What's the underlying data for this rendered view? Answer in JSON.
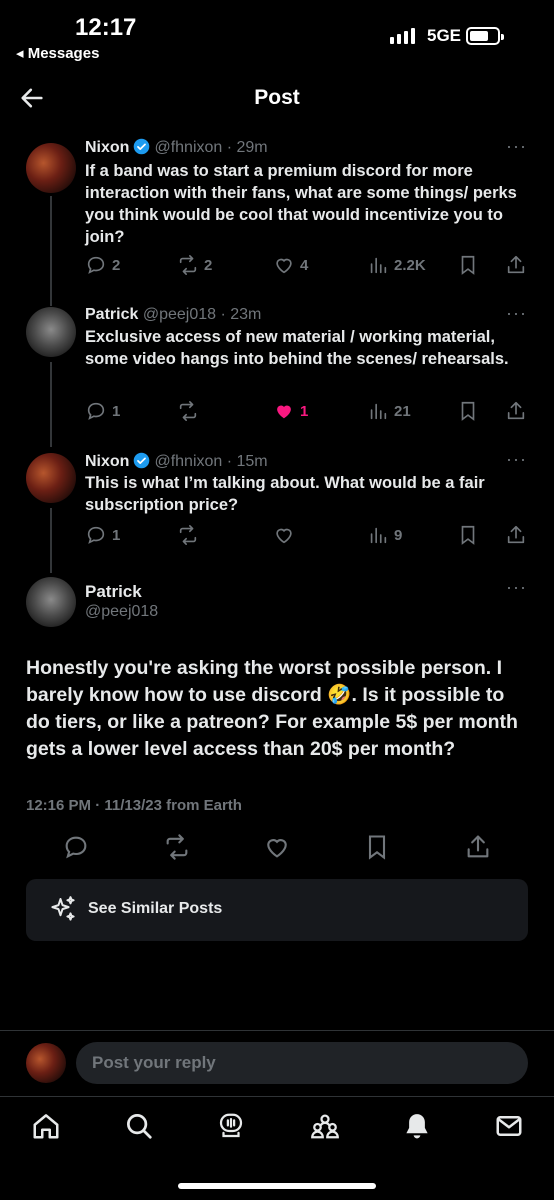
{
  "status_bar": {
    "time": "12:17",
    "back_app": "◂ Messages",
    "network": "5GE"
  },
  "header": {
    "title": "Post"
  },
  "replies": [
    {
      "name": "Nixon",
      "verified": true,
      "handle": "@fhnixon · 29m",
      "text": "If a band was to start a premium discord for more interaction with their fans, what are some things/ perks you think would be cool that would incentivize you to join?",
      "replies_count": "2",
      "reposts_count": "2",
      "likes_count": "4",
      "views_count": "2.2K"
    },
    {
      "name": "Patrick",
      "verified": false,
      "handle": "@peej018 · 23m",
      "text": "Exclusive access of new material / working material, some video hangs into behind the scenes/ rehearsals.",
      "replies_count": "1",
      "reposts_count": "",
      "likes_count": "1",
      "views_count": "21"
    },
    {
      "name": "Nixon",
      "verified": true,
      "handle": "@fhnixon · 15m",
      "text": "This is what I’m talking about. What would be a fair subscription price?",
      "replies_count": "1",
      "reposts_count": "",
      "likes_count": "",
      "views_count": "9"
    }
  ],
  "main_post": {
    "name": "Patrick",
    "handle": "@peej018",
    "text": "Honestly you're asking the worst possible person. I barely know how to use discord 🤣. Is it possible to do tiers, or like a patreon? For example 5$ per month gets a lower level access than 20$ per month?",
    "timestamp": "12:16 PM · 11/13/23",
    "location": " from Earth"
  },
  "similar_posts": {
    "label": "See Similar Posts"
  },
  "reply_bar": {
    "placeholder": "Post your reply"
  },
  "colors": {
    "background": "#000000",
    "text": "#e7e9ea",
    "muted": "#71767b",
    "like": "#f91880",
    "verified": "#1d9bf0"
  },
  "icons": {
    "tabs": [
      "home-icon",
      "search-icon",
      "grok-icon",
      "communities-icon",
      "notifications-icon",
      "messages-icon"
    ]
  }
}
